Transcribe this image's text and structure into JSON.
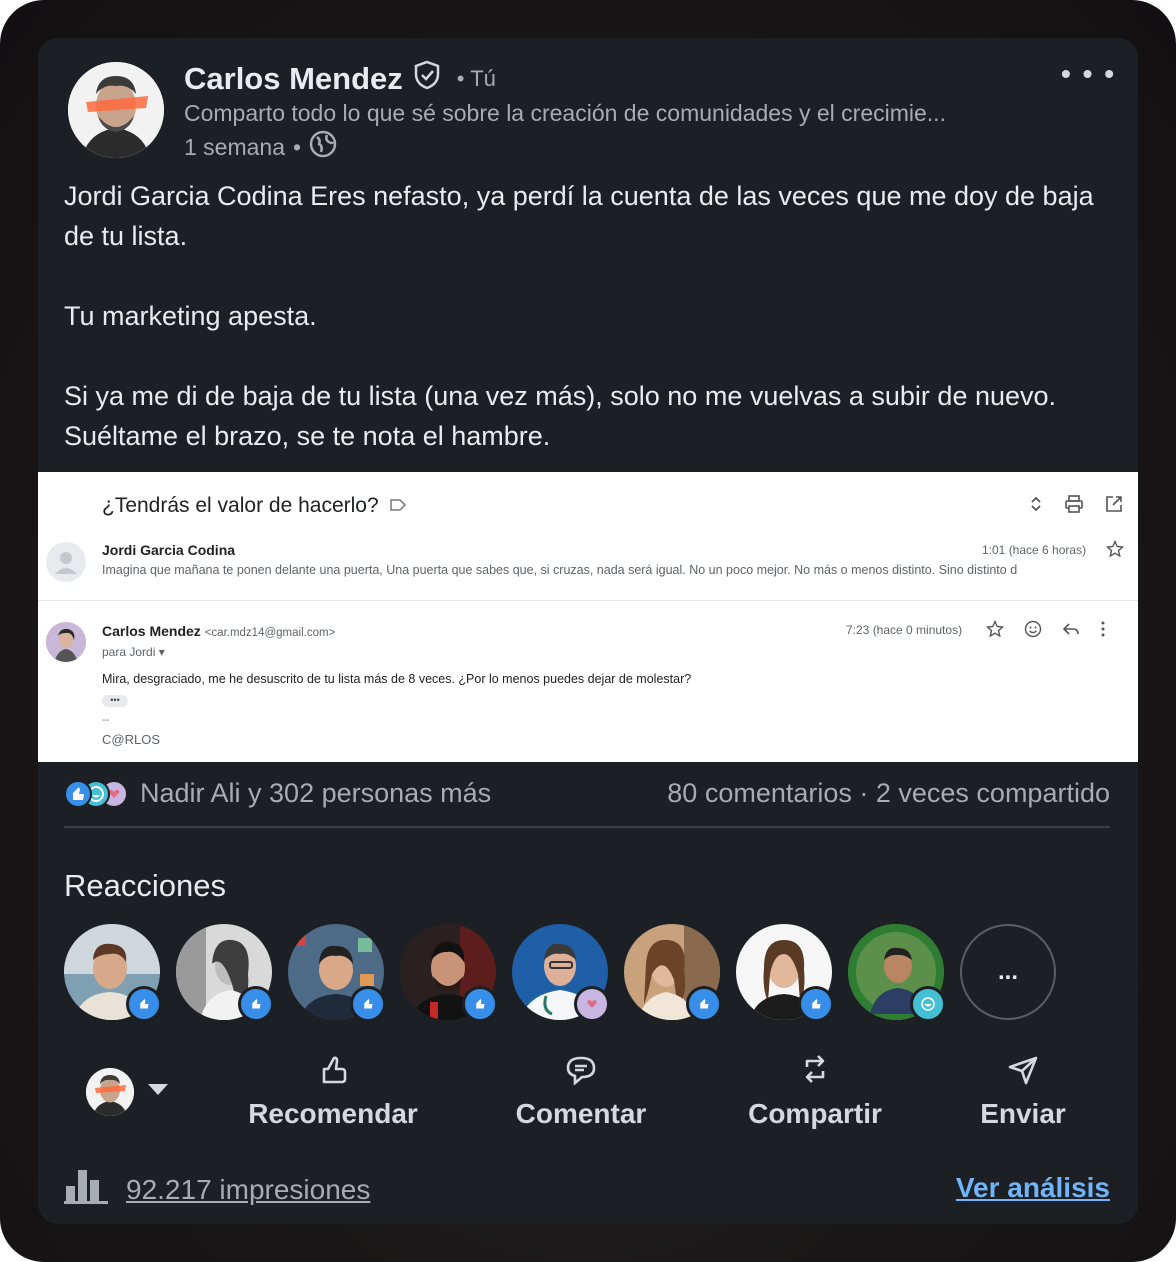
{
  "author": {
    "name": "Carlos Mendez",
    "you_label": "• Tú",
    "headline": "Comparto todo lo que sé sobre la creación de comunidades y el crecimie...",
    "time": "1 semana",
    "time_sep": "•"
  },
  "post": {
    "paragraphs": [
      "Jordi Garcia Codina Eres nefasto, ya perdí la cuenta de las veces que me doy de baja de tu lista.",
      "Tu marketing apesta.",
      "Si ya me di de baja de tu lista (una vez más), solo no me vuelvas a subir de nuevo. Suéltame el brazo, se te nota el hambre."
    ]
  },
  "email": {
    "subject": "¿Tendrás el valor de hacerlo?",
    "first": {
      "sender": "Jordi Garcia Codina",
      "time": "1:01 (hace 6 horas)",
      "snippet": "Imagina que mañana te ponen delante una puerta, Una puerta que sabes que, si cruzas, nada será igual. No un poco mejor. No más o menos distinto. Sino distinto d"
    },
    "reply": {
      "sender": "Carlos Mendez",
      "address": "<car.mdz14@gmail.com>",
      "to": "para Jordi",
      "time": "7:23 (hace 0 minutos)",
      "body": "Mira, desgraciado, me he desuscrito de tu lista más de 8 veces. ¿Por lo menos puedes dejar de molestar?",
      "dots": "•••",
      "dash": "--",
      "signature": "C@RLOS"
    }
  },
  "stats": {
    "reactions_text": "Nadir Ali y 302 personas más",
    "comments_shares": "80 comentarios · 2 veces compartido"
  },
  "reactions_section": {
    "title": "Reacciones",
    "more": "...",
    "reactors": [
      {
        "reaction": "like"
      },
      {
        "reaction": "like"
      },
      {
        "reaction": "like"
      },
      {
        "reaction": "like"
      },
      {
        "reaction": "love"
      },
      {
        "reaction": "like"
      },
      {
        "reaction": "like"
      },
      {
        "reaction": "funny"
      }
    ]
  },
  "actions": {
    "recommend": "Recomendar",
    "comment": "Comentar",
    "share": "Compartir",
    "send": "Enviar"
  },
  "footer": {
    "impressions": "92.217 impresiones",
    "analytics": "Ver análisis"
  },
  "colors": {
    "card_bg": "#1c1f24",
    "text_primary": "#e9ebee",
    "text_secondary": "#a7acb3",
    "link": "#70b5f9",
    "like_blue": "#378fe9"
  }
}
